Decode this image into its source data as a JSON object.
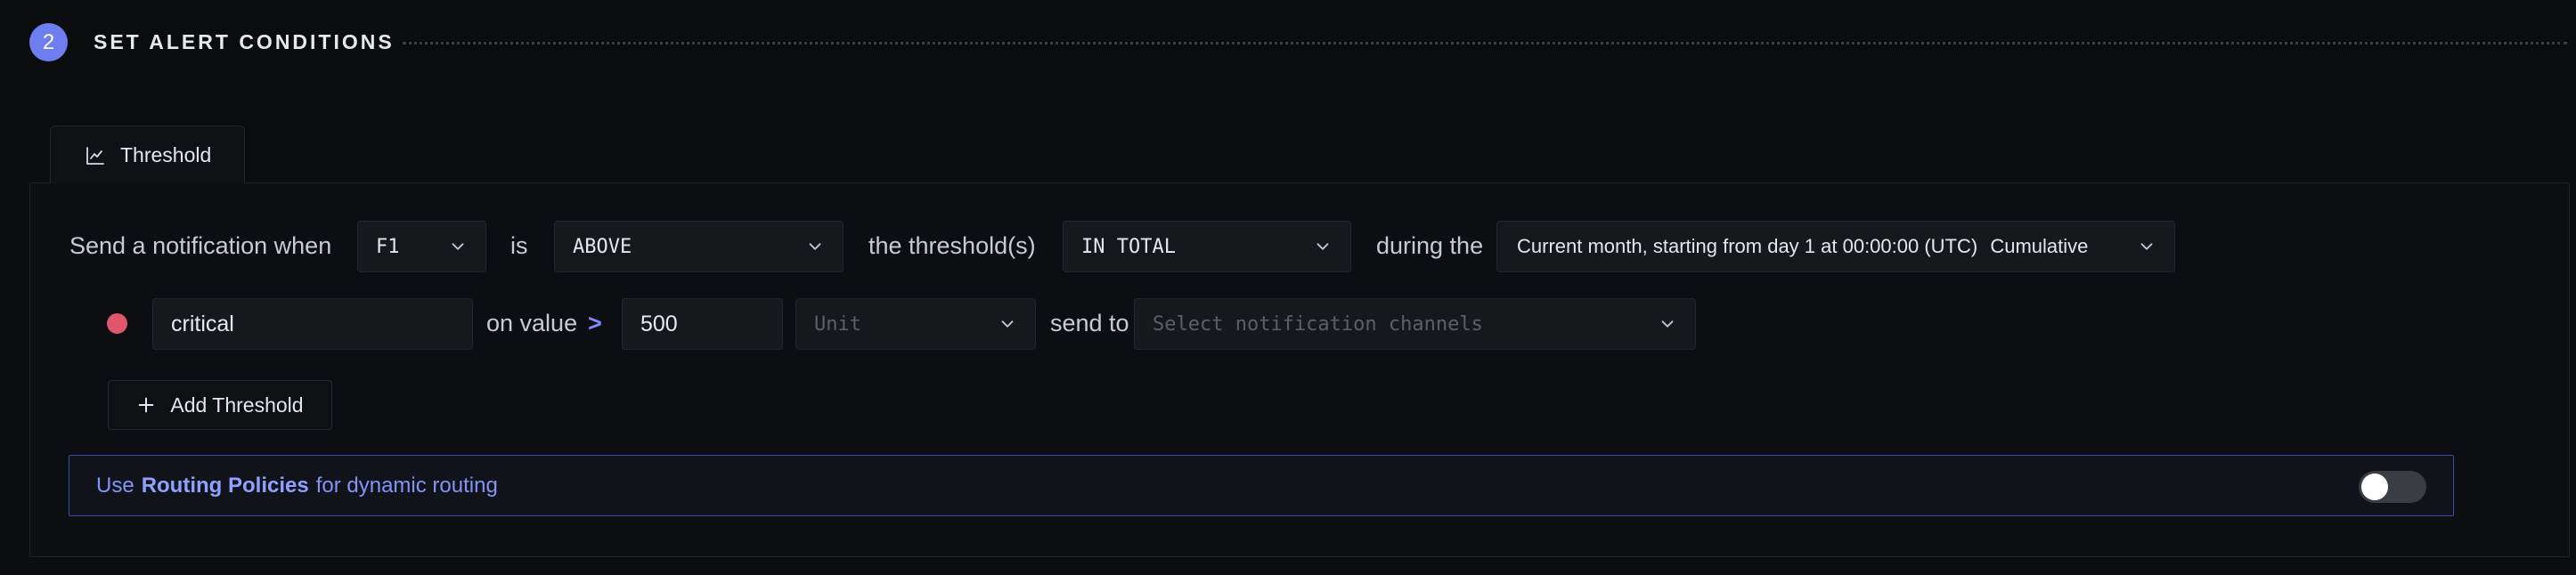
{
  "step": {
    "number": "2",
    "title": "SET ALERT CONDITIONS"
  },
  "tab": {
    "label": "Threshold",
    "icon": "line-chart-icon"
  },
  "condition": {
    "prefix": "Send a notification when",
    "query_select": "F1",
    "is_text": "is",
    "operator_select": "ABOVE",
    "threshold_text": "the threshold(s)",
    "match_select": "IN TOTAL",
    "during_text": "during the",
    "evaluation_window": "Current month, starting from day 1 at 00:00:00 (UTC)",
    "evaluation_window_type": "Cumulative"
  },
  "threshold": {
    "severity_color": "#e0566c",
    "name": "critical",
    "on_value_text": "on value",
    "comparator": ">",
    "value": "500",
    "unit_placeholder": "Unit",
    "send_to_text": "send to",
    "channels_placeholder": "Select notification channels"
  },
  "add_threshold": {
    "label": "Add Threshold"
  },
  "routing": {
    "prefix": "Use",
    "link": "Routing Policies",
    "suffix": "for dynamic routing",
    "enabled": false
  },
  "colors": {
    "accent": "#6c7ef0",
    "link": "#8494f5",
    "critical": "#e0566c",
    "background": "#0b0c0e"
  }
}
